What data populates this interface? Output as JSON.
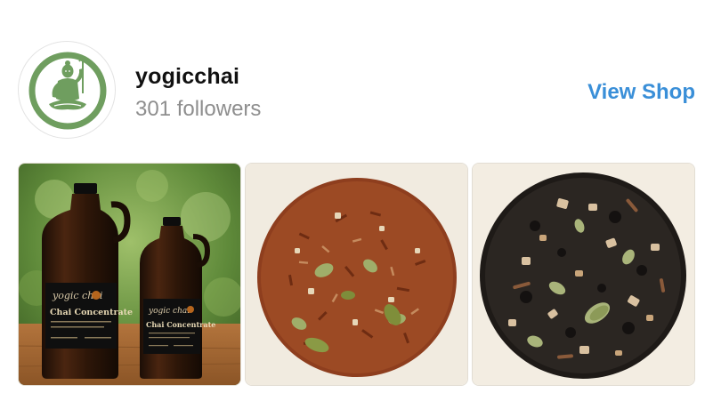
{
  "shop": {
    "name": "yogicchai",
    "followers": "301 followers",
    "view_shop_label": "View Shop",
    "avatar_icon": "meditating-figure-logo-icon",
    "accent_color": "#3a8fd8",
    "logo_color": "#6f9e5f"
  },
  "products": [
    {
      "name": "chai-concentrate-growlers",
      "label_brand": "yogic chai",
      "label_title": "Chai Concentrate"
    },
    {
      "name": "rooibos-chai-loose-leaf"
    },
    {
      "name": "black-chai-loose-leaf"
    }
  ]
}
